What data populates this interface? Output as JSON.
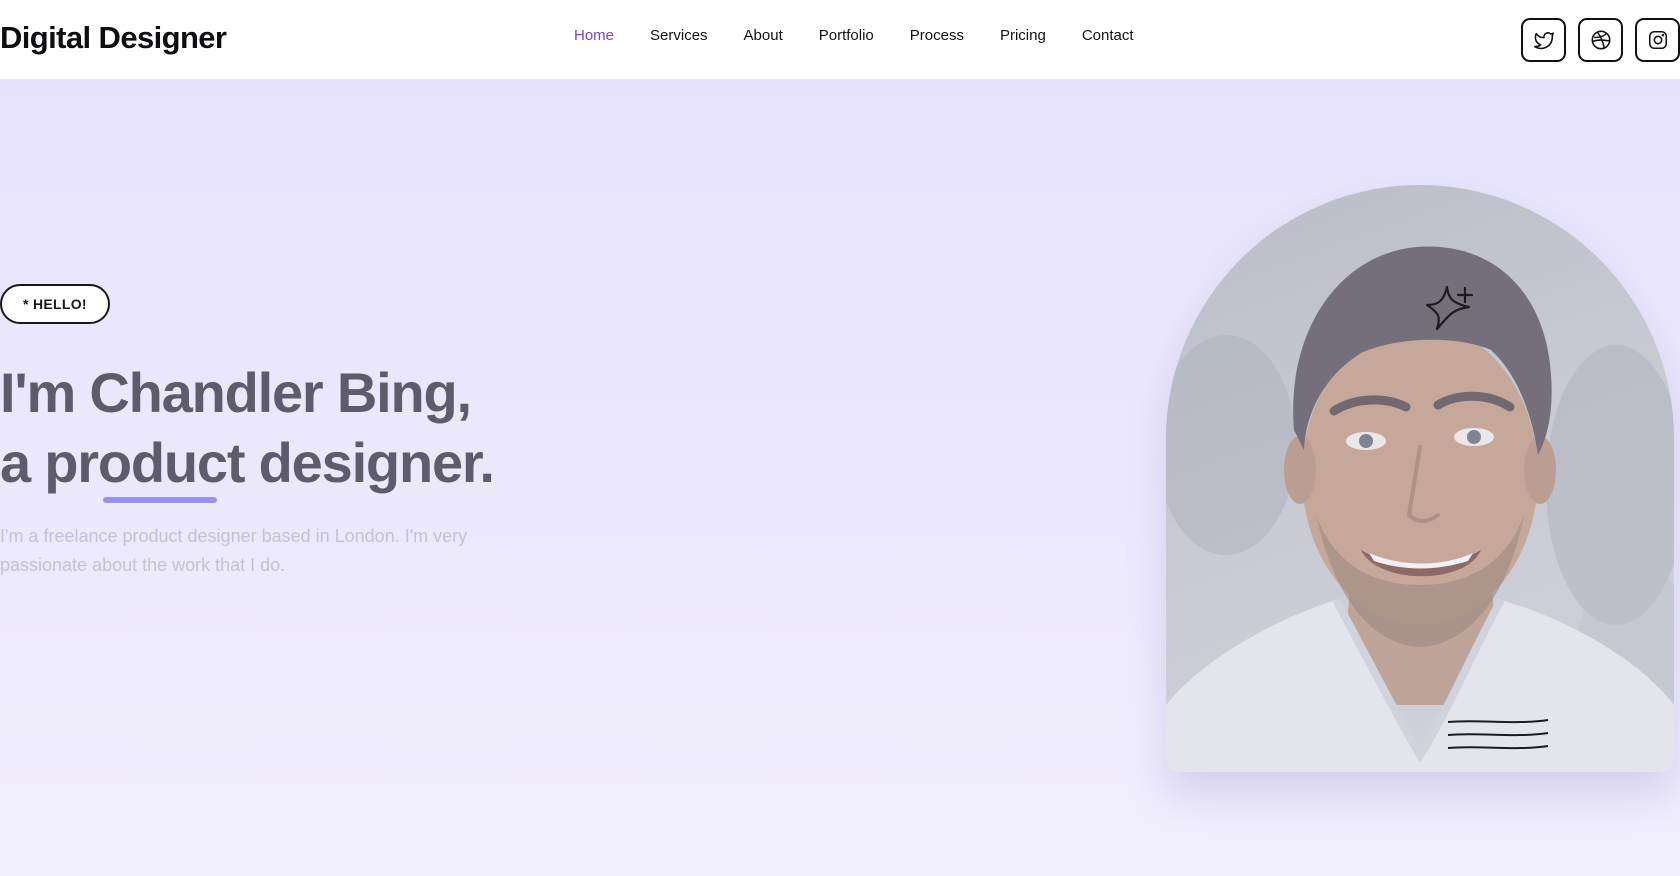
{
  "brand": {
    "name": "Digital Designer"
  },
  "nav": {
    "items": [
      {
        "label": "Home",
        "active": true
      },
      {
        "label": "Services",
        "active": false
      },
      {
        "label": "About",
        "active": false
      },
      {
        "label": "Portfolio",
        "active": false
      },
      {
        "label": "Process",
        "active": false
      },
      {
        "label": "Pricing",
        "active": false
      },
      {
        "label": "Contact",
        "active": false
      }
    ]
  },
  "socials": [
    {
      "icon": "twitter-icon"
    },
    {
      "icon": "dribbble-icon"
    },
    {
      "icon": "instagram-icon"
    }
  ],
  "hero": {
    "badge": "* HELLO!",
    "headline_line1": "I'm Chandler Bing,",
    "headline_line2": "a product designer.",
    "intro": "I'm a freelance product designer based in London. I'm very passionate about the work that I do.",
    "portrait_icon": "designer-portrait-photo",
    "decor": [
      "sparkle-icon",
      "squiggle-lines-icon"
    ]
  },
  "colors": {
    "accent": "#7a3fe0",
    "hero_bg": "#e7e3fd",
    "headline": "#5e5c6a",
    "underline": "#9a91ee",
    "text_muted": "#c4c0d8"
  }
}
